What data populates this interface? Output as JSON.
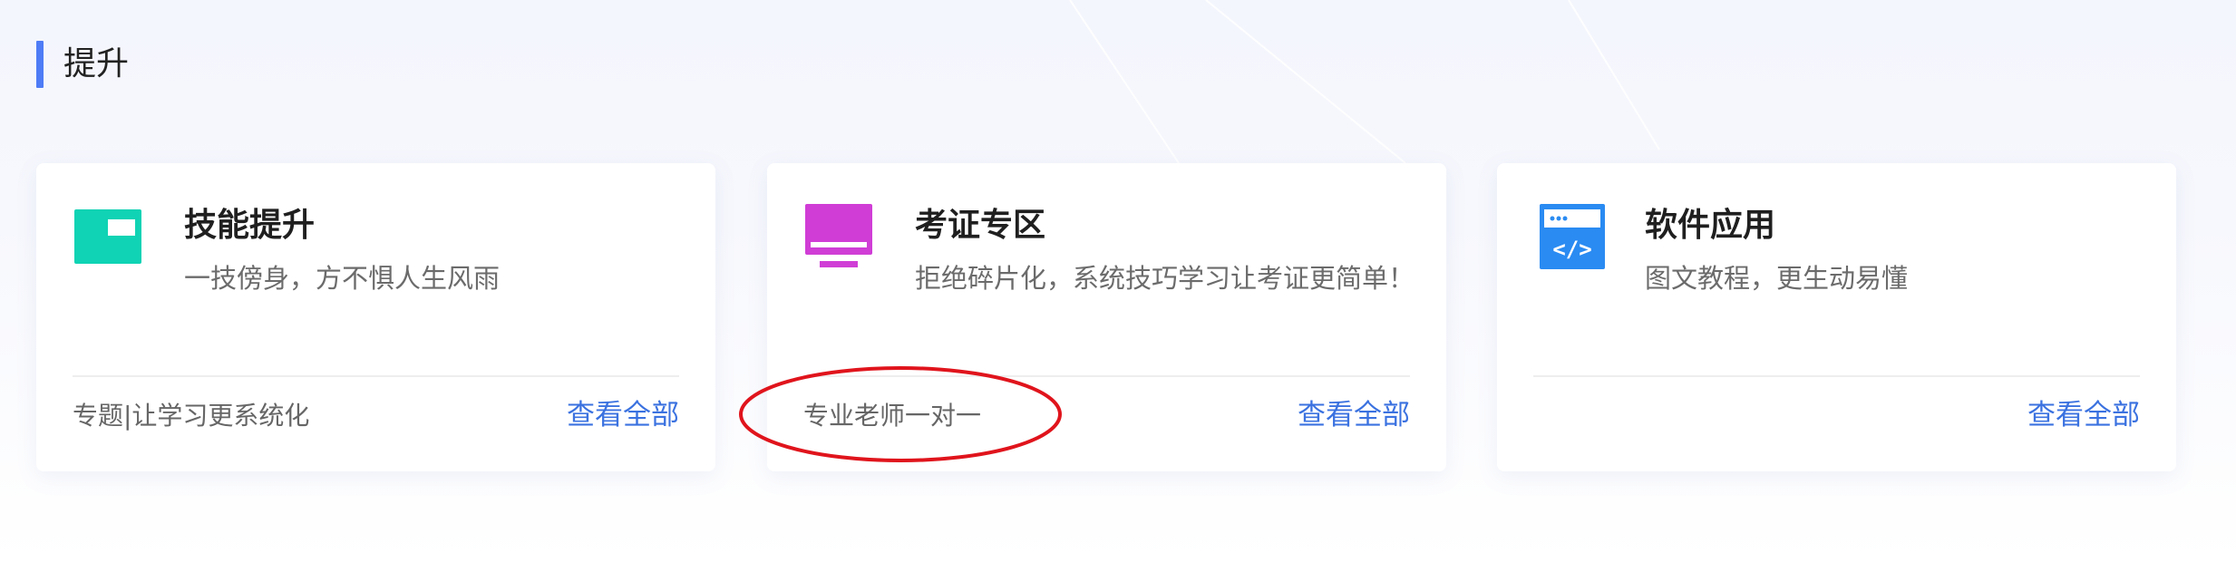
{
  "section": {
    "title": "提升",
    "accent_color": "#4e7cf6"
  },
  "cards": [
    {
      "icon": "panel-icon",
      "icon_color": "#0fd3b4",
      "title": "技能提升",
      "description": "一技傍身，方不惧人生风雨",
      "tag": "专题|让学习更系统化",
      "link": "查看全部"
    },
    {
      "icon": "monitor-icon",
      "icon_color": "#d03dd6",
      "title": "考证专区",
      "description": "拒绝碎片化，系统技巧学习让考证更简单！",
      "tag": "专业老师一对一",
      "link": "查看全部"
    },
    {
      "icon": "code-window-icon",
      "icon_color": "#2a8bf2",
      "title": "软件应用",
      "description": "图文教程，更生动易懂",
      "tag": "",
      "link": "查看全部"
    }
  ],
  "colors": {
    "link": "#3b72e0",
    "annotation": "#e0141c"
  }
}
